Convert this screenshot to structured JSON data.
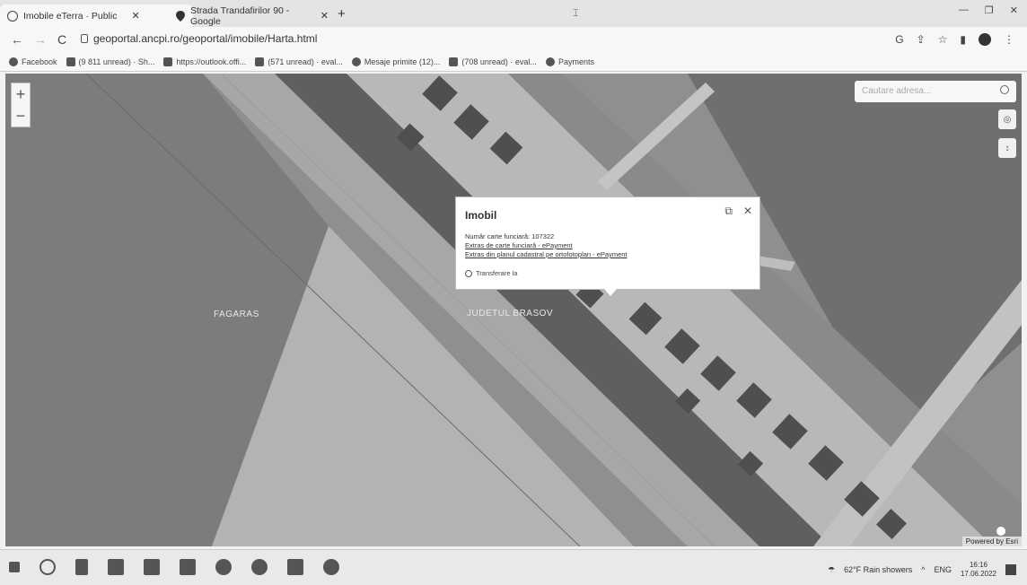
{
  "browser": {
    "tabs": [
      {
        "title": "Imobile eTerra · Public"
      },
      {
        "title": "Strada Trandafirilor 90 - Google"
      }
    ],
    "new_tab_label": "+",
    "url": "geoportal.ancpi.ro/geoportal/imobile/Harta.html",
    "bookmarks": [
      {
        "label": "Facebook"
      },
      {
        "label": "(9 811 unread) · Sh..."
      },
      {
        "label": "https://outlook.offi..."
      },
      {
        "label": "(571 unread) · eval..."
      },
      {
        "label": "Mesaje primite (12)..."
      },
      {
        "label": "(708 unread) · eval..."
      },
      {
        "label": "Payments"
      }
    ]
  },
  "map": {
    "zoom_in": "+",
    "zoom_out": "−",
    "search_placeholder": "Cautare adresa...",
    "labels": {
      "left": "FAGARAS",
      "center": "JUDETUL BRASOV"
    },
    "powered_by": "Powered by Esri"
  },
  "popup": {
    "title": "Imobil",
    "cf_number": "Număr carte funciară: 107322",
    "link_extras_cf": "Extras de carte funciară - ePayment",
    "link_extras_plan": "Extras din planul cadastral pe ortofotoplan - ePayment",
    "transfer_label": "Transferare la"
  },
  "taskbar": {
    "weather": "62°F  Rain showers",
    "lang": "ENG",
    "time": "16:16",
    "date": "17.06.2022"
  }
}
